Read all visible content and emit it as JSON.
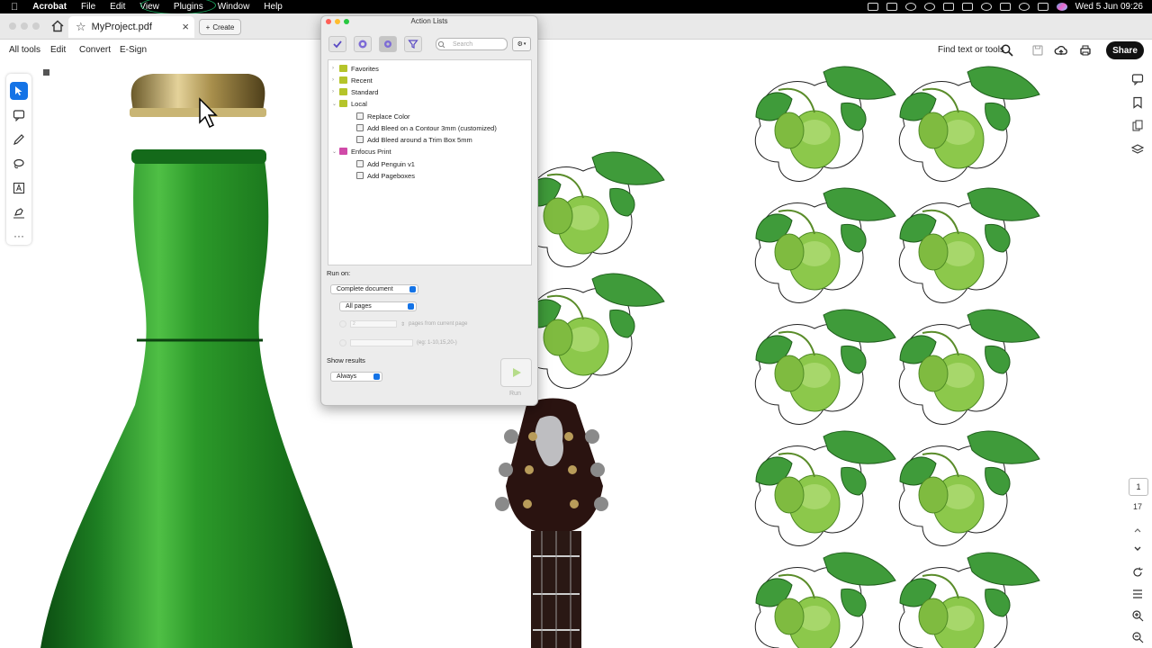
{
  "menubar": {
    "app": "Acrobat",
    "items": [
      "File",
      "Edit",
      "View",
      "Plugins",
      "Window",
      "Help"
    ],
    "datetime": "Wed 5 Jun  09:26"
  },
  "tab": {
    "title": "MyProject.pdf",
    "create": "Create"
  },
  "toolbar": {
    "items": [
      "All tools",
      "Edit",
      "Convert",
      "E-Sign"
    ],
    "find": "Find text or tools",
    "share": "Share"
  },
  "page_nav": {
    "current": "1",
    "total": "17"
  },
  "action_lists": {
    "title": "Action Lists",
    "search_placeholder": "Search",
    "tree": [
      {
        "label": "Favorites",
        "level": 0,
        "kind": "folder",
        "expanded": false
      },
      {
        "label": "Recent",
        "level": 0,
        "kind": "folder",
        "expanded": false
      },
      {
        "label": "Standard",
        "level": 0,
        "kind": "folder",
        "expanded": false
      },
      {
        "label": "Local",
        "level": 0,
        "kind": "folder",
        "expanded": true
      },
      {
        "label": "Replace Color",
        "level": 1,
        "kind": "action"
      },
      {
        "label": "Add Bleed on a Contour 3mm (customized)",
        "level": 1,
        "kind": "action"
      },
      {
        "label": "Add Bleed around a Trim Box 5mm",
        "level": 1,
        "kind": "action"
      },
      {
        "label": "Enfocus Print",
        "level": 0,
        "kind": "folder-pink",
        "expanded": true
      },
      {
        "label": "Add Penguin v1",
        "level": 1,
        "kind": "action"
      },
      {
        "label": "Add Pageboxes",
        "level": 1,
        "kind": "action"
      }
    ],
    "run_on_label": "Run on:",
    "run_on_value": "Complete document",
    "pages_value": "All pages",
    "pages_count_value": "2",
    "pages_from_label": "pages from current page",
    "range_hint": "(eg: 1-10,15,20-)",
    "show_results_label": "Show results",
    "show_results_value": "Always",
    "run_label": "Run"
  },
  "colors": {
    "accent": "#1473e6",
    "folder": "#b5c42a",
    "folder_pink": "#d04aa8",
    "bottle_green": "#1f8a2a"
  }
}
